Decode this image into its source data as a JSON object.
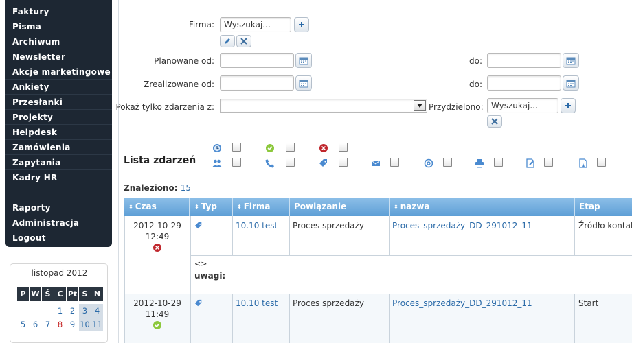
{
  "sidebar": {
    "items": [
      "Faktury",
      "Pisma",
      "Archiwum",
      "Newsletter",
      "Akcje marketingowe",
      "Ankiety",
      "Przesłanki",
      "Projekty",
      "Helpdesk",
      "Zamówienia",
      "Zapytania",
      "Kadry HR"
    ],
    "bottom_items": [
      "Raporty",
      "Administracja",
      "Logout"
    ]
  },
  "calendar": {
    "title": "listopad 2012",
    "weekdays": [
      "P",
      "W",
      "Ś",
      "C",
      "Pt",
      "S",
      "N"
    ],
    "rows": [
      [
        "",
        "",
        "",
        "1",
        "2",
        "3",
        "4"
      ],
      [
        "5",
        "6",
        "7",
        "8",
        "9",
        "10",
        "11"
      ]
    ]
  },
  "form": {
    "firma_label": "Firma:",
    "firma_value": "Wyszukaj...",
    "planowane_label": "Planowane od:",
    "zrealizowane_label": "Zrealizowane od:",
    "do_label": "do:",
    "pokaz_label": "Pokaż tylko zdarzenia z:",
    "przydzielono_label": "Przydzielono:",
    "przydzielono_value": "Wyszukaj..."
  },
  "lista": {
    "title": "Lista zdarzeń",
    "icons": [
      "clock-icon",
      "check-icon",
      "cancel-icon",
      "people-icon",
      "phone-icon",
      "tag-icon",
      "envelope-icon",
      "email-at-icon",
      "printer-icon",
      "edit-doc-icon",
      "doc-user-icon"
    ]
  },
  "found": {
    "label": "Znaleziono:",
    "count": "15"
  },
  "table": {
    "headers": [
      "Czas",
      "Typ",
      "Firma",
      "Powiązanie",
      "nazwa",
      "Etap"
    ],
    "rows": [
      {
        "date": "2012-10-29",
        "time": "12:49",
        "status": "cancelled",
        "firma": "10.10 test",
        "powiazanie": "Proces sprzedaży",
        "nazwa": "Proces_sprzedaży_DD_291012_11",
        "etap": "Źródło kontaktu",
        "detail_symbol": "<>",
        "uwagi_label": "uwagi:"
      },
      {
        "date": "2012-10-29",
        "time": "11:49",
        "status": "done",
        "firma": "10.10 test",
        "powiazanie": "Proces sprzedaży",
        "nazwa": "Proces_sprzedaży_DD_291012_11",
        "etap": "Start"
      }
    ]
  },
  "colors": {
    "sidebar": "#1d2733",
    "header_blue": "#6aa8db",
    "link": "#2a6aa8",
    "cancel_red": "#c0272d",
    "check_green": "#6bb52a"
  }
}
